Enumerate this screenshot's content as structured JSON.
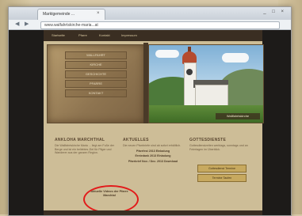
{
  "browser": {
    "tab_title": "Marktgemeinde ...",
    "tab_close": "×",
    "url": "www.walfahrtskirche-maria...at",
    "window_controls": "_ □ ×",
    "nav_back": "◀",
    "nav_forward": "▶"
  },
  "site": {
    "topnav": [
      "Startseite",
      "Pfarre",
      "Kontakt",
      "Impressum"
    ],
    "menu_items": [
      "WALLFAHRT",
      "KIRCHE",
      "GESCHICHTE",
      "PFARRE",
      "KONTAKT"
    ],
    "photo_caption": "Wallfahrtskirche"
  },
  "columns": [
    {
      "heading": "ANKLOHA MARCHTHAL",
      "text": "Die Wallfahrtskirche Maria ... liegt am Fuße der Berge und ist ein beliebtes Ziel für Pilger und Wanderer aus der ganzen Region.",
      "highlight": "Aktuelle Videos der Pfarre Marchtal"
    },
    {
      "heading": "AKTUELLES",
      "text": "Die neuen Pfarrbriefe sind ab sofort erhältlich.",
      "item1": "Pfarrfest 2013 Einladung",
      "item2": "Erntedank 2013 Einladung",
      "item3": "Pfarrbrief Nov. / Dez. 2013 Download"
    },
    {
      "heading": "GOTTESDIENSTE",
      "text": "Gottesdienstzeiten werktags, sonntags und an Feiertagen im Überblick.",
      "btn1": "Gottesdienst Termine",
      "btn2": "Termine Taufen"
    }
  ],
  "colors": {
    "accent_highlight": "#e21a1a",
    "site_background": "#cdbd97",
    "dark_frame": "#1d1b19"
  }
}
